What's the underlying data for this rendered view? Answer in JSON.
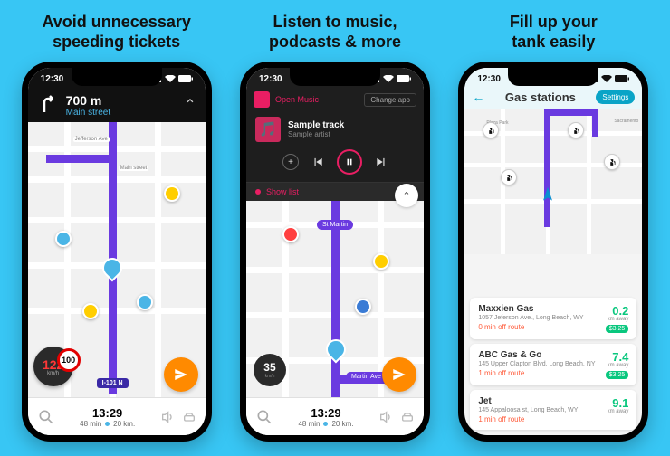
{
  "status_time": "12:30",
  "headings": {
    "p1": "Avoid unnecessary\nspeeding tickets",
    "p2": "Listen to music,\npodcasts & more",
    "p3": "Fill up your\ntank easily"
  },
  "p1": {
    "distance": "700 m",
    "street": "Main street",
    "speed_val": "122",
    "speed_unit": "km/h",
    "speed_limit": "100",
    "route_label": "I-101 N",
    "road1": "Jefferson Ave",
    "road2": "Main street",
    "arrival": "13:29",
    "duration": "48 min",
    "remaining": "20 km."
  },
  "p2": {
    "open_label": "Open Music",
    "change_label": "Change app",
    "track": "Sample track",
    "artist": "Sample artist",
    "showlist": "Show list",
    "speed": "35",
    "speed_unit": "km/h",
    "street1": "St Martin",
    "street2": "Martin Ave",
    "arrival": "13:29",
    "duration": "48 min",
    "remaining": "20 km."
  },
  "p3": {
    "title": "Gas stations",
    "settings": "Settings",
    "map_labels": {
      "a": "Plaza Park",
      "b": "Sacramento"
    },
    "cards": [
      {
        "name": "Maxxien Gas",
        "addr": "1057 Jeferson Ave., Long Beach, WY",
        "off": "0 min off route",
        "dist": "0.2",
        "unit": "km away",
        "price": "$3.25"
      },
      {
        "name": "ABC Gas & Go",
        "addr": "145 Upper Clapton Blvd, Long Beach, NY",
        "off": "1 min off route",
        "dist": "7.4",
        "unit": "km away",
        "price": "$3.25"
      },
      {
        "name": "Jet",
        "addr": "145 Appaloosa st, Long Beach, WY",
        "off": "1 min off route",
        "dist": "9.1",
        "unit": "km away",
        "price": ""
      }
    ]
  }
}
